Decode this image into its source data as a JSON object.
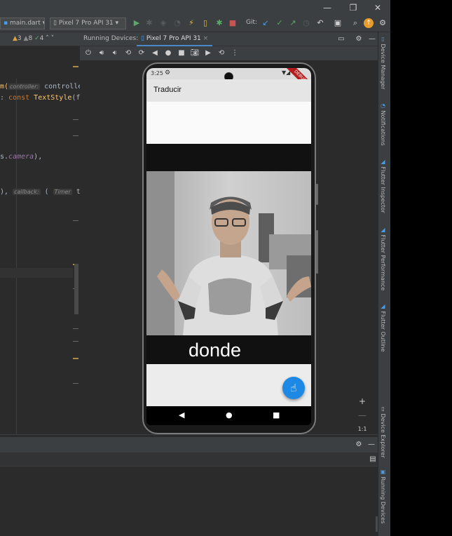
{
  "titlebar": {
    "minimize": "—",
    "restore": "❐",
    "close": "✕"
  },
  "toolbar": {
    "file_combo": "main.dart",
    "device_combo": "Pixel 7 Pro API 31",
    "git_label": "Git:"
  },
  "editor": {
    "inspection": {
      "warn1": "3",
      "warn2": "8",
      "ok": "4"
    },
    "lines": [
      {
        "pre": "m(",
        "hint": "controller:",
        "post": "controlle"
      },
      {
        "pre": ": ",
        "kw": "const ",
        "cls": "TextStyle",
        "post": "(f"
      },
      {
        "pre": "s.",
        "ital": "camera",
        "post": "),"
      },
      {
        "pre": "),  ",
        "hint": "callback:",
        "post": "( ",
        "hint2": "Timer",
        "post2": " t:"
      }
    ]
  },
  "running_devices": {
    "title": "Running Devices:",
    "tab": "Pixel 7 Pro API 31"
  },
  "zoom": {
    "plus": "+",
    "minus": "—",
    "ratio": "1:1"
  },
  "phone": {
    "time": "3:25",
    "debug": "DEBUG",
    "app_title": "Traducir",
    "caption": "donde",
    "nav_back": "◀",
    "nav_home": "●",
    "nav_recent": "■"
  },
  "right_tabs": [
    "Device Manager",
    "Notifications",
    "Flutter Inspector",
    "Flutter Performance",
    "Flutter Outline",
    "Device Explorer",
    "Running Devices"
  ],
  "colors": {
    "accent": "#4a88c7",
    "fab": "#1e88e5",
    "ide_bg": "#2b2b2b"
  }
}
